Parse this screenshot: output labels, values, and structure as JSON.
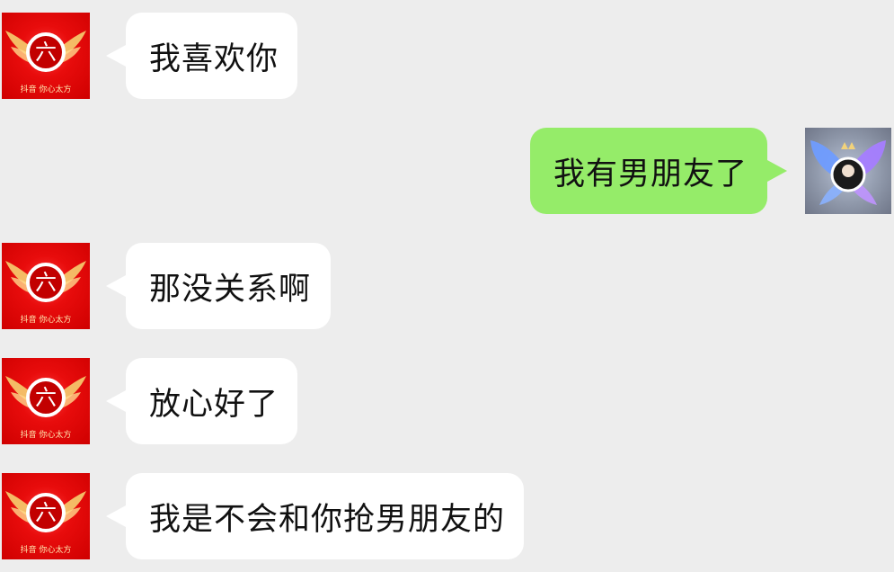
{
  "messages": [
    {
      "side": "left",
      "text": "我喜欢你"
    },
    {
      "side": "right",
      "text": "我有男朋友了"
    },
    {
      "side": "left",
      "text": "那没关系啊"
    },
    {
      "side": "left",
      "text": "放心好了"
    },
    {
      "side": "left",
      "text": "我是不会和你抢男朋友的"
    }
  ],
  "contact_avatar": {
    "glyph": "六",
    "caption": "抖音 你心太方",
    "colors": {
      "background": "#e00000",
      "ring": "#ffffff",
      "wings": "#f4c56a"
    }
  },
  "self_avatar": {
    "icon": "butterfly-portrait-avatar",
    "colors": {
      "wings": "#7fa8ff",
      "center": "#1b1b1b",
      "crown": "#f2d27a"
    }
  },
  "colors": {
    "chat_background": "#ededed",
    "incoming_bubble": "#ffffff",
    "outgoing_bubble": "#95ec69"
  }
}
